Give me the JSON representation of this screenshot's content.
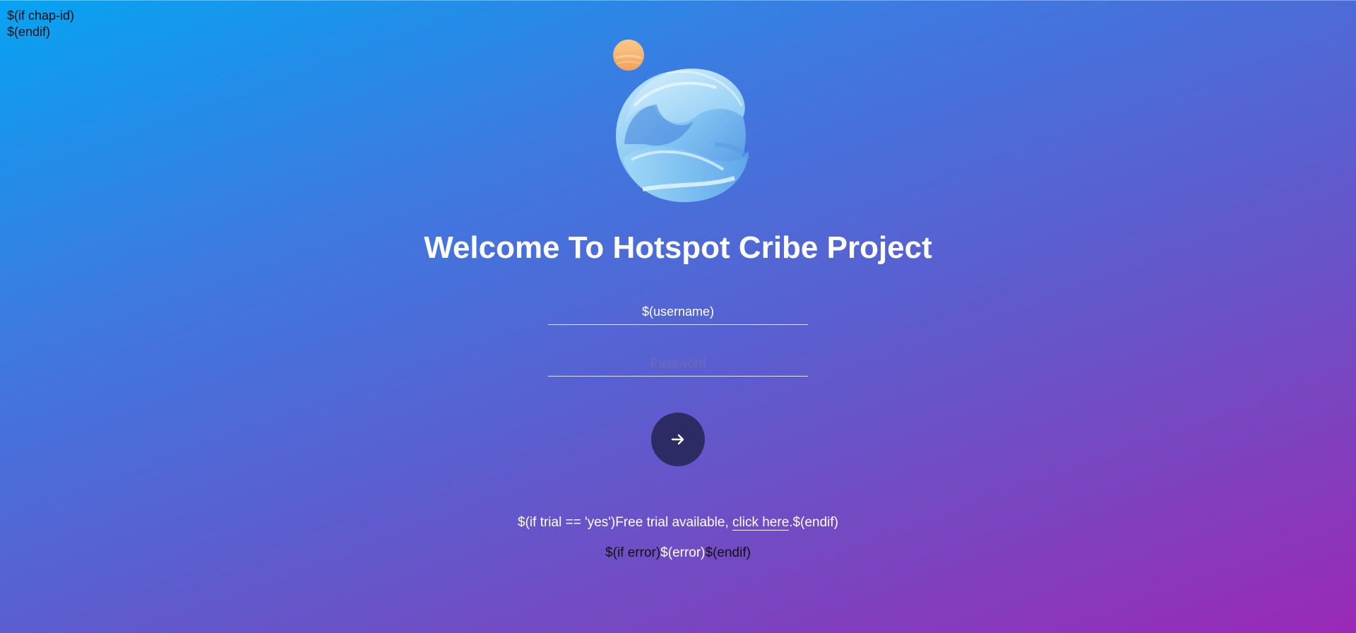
{
  "chap": {
    "if_line": "$(if chap-id)",
    "endif_line": "$(endif)"
  },
  "logo": {
    "icon": "hotspot-logo-icon",
    "sun_color": "#f7b26b",
    "wave_colors": [
      "#a8dcf7",
      "#6fb3ec",
      "#3f7fdd"
    ]
  },
  "title": "Welcome To Hotspot Cribe Project",
  "form": {
    "username_value": "$(username)",
    "password_placeholder": "Password",
    "submit_icon": "arrow-right-icon",
    "submit_color": "#2d2b63"
  },
  "trial": {
    "prefix": "$(if trial == 'yes')Free trial available, ",
    "link_label": "click here",
    "suffix": ".$(endif)"
  },
  "error": {
    "prefix": "$(if error)",
    "message": "$(error)",
    "suffix": "$(endif)"
  },
  "colors": {
    "gradient_start": "#06a3f2",
    "gradient_end": "#9a29b6"
  }
}
